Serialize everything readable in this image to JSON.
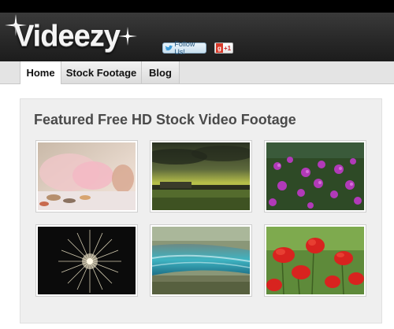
{
  "header": {
    "logo_text": "Videezy",
    "follow_label": "Follow Us!",
    "gplus_label": "+1",
    "gplus_icon": "g"
  },
  "nav": {
    "tabs": [
      {
        "label": "Home",
        "active": true
      },
      {
        "label": "Stock Footage",
        "active": false
      },
      {
        "label": "Blog",
        "active": false
      }
    ]
  },
  "featured": {
    "title": "Featured Free HD Stock Video Footage",
    "thumbnails": [
      {
        "subject": "baby-playing"
      },
      {
        "subject": "stormy-field"
      },
      {
        "subject": "purple-flowers"
      },
      {
        "subject": "fireworks"
      },
      {
        "subject": "waterfall"
      },
      {
        "subject": "red-poppies"
      }
    ]
  },
  "colors": {
    "header_bg": "#2a2a2a",
    "nav_bg": "#e4e4e4",
    "panel_bg": "#efefef",
    "title_text": "#4a4a4a"
  }
}
